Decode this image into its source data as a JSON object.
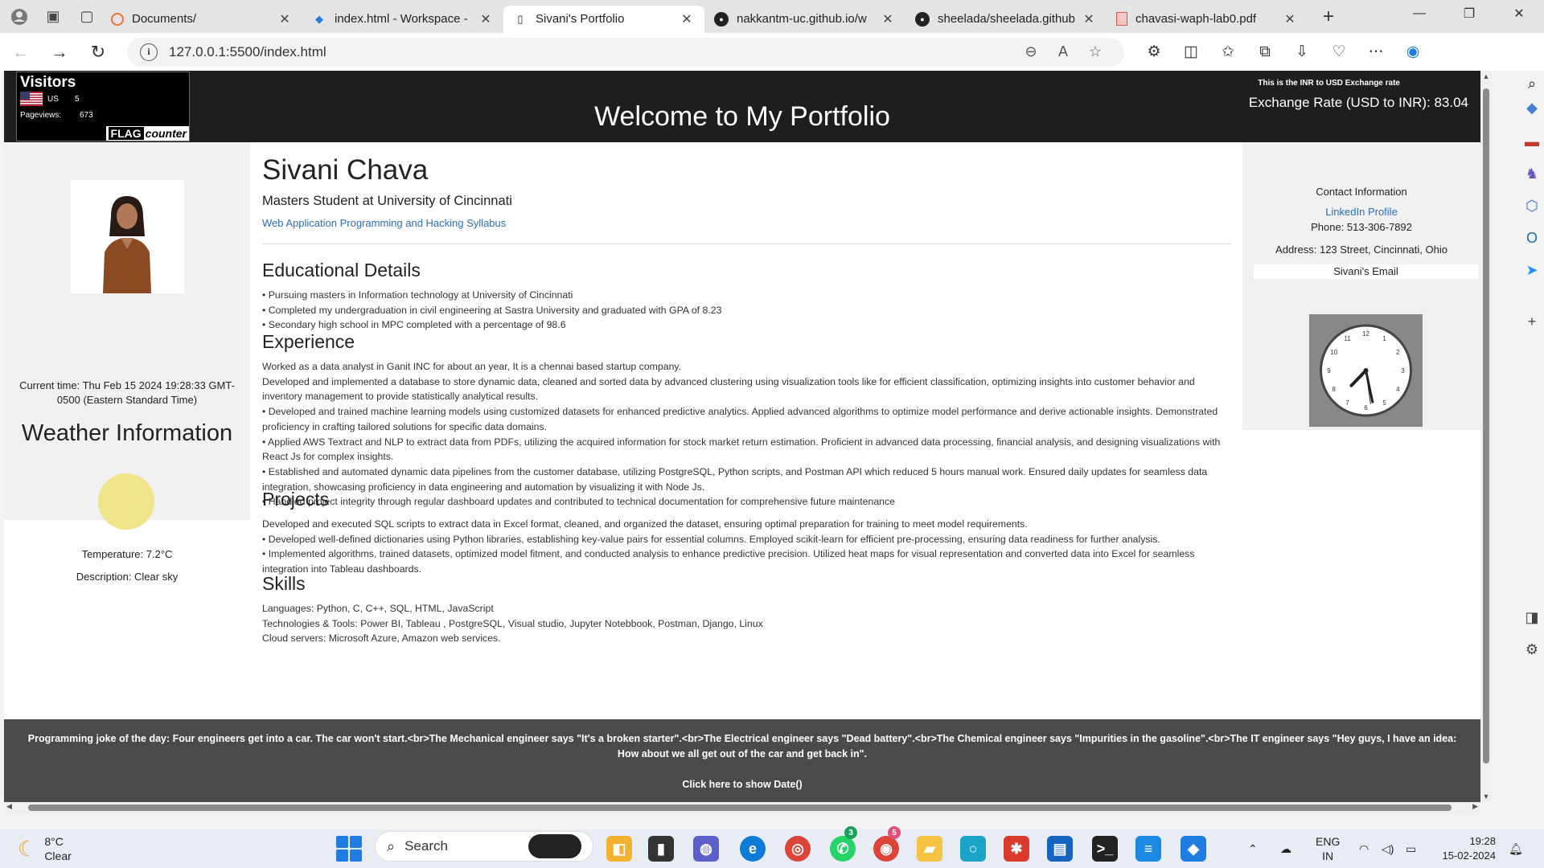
{
  "browser": {
    "tabs": [
      {
        "title": "Documents/",
        "favicon": "orange-ring-icon"
      },
      {
        "title": "index.html - Workspace -",
        "favicon": "vscode-icon"
      },
      {
        "title": "Sivani's Portfolio",
        "favicon": "page-icon"
      },
      {
        "title": "nakkantm-uc.github.io/w",
        "favicon": "github-icon"
      },
      {
        "title": "sheelada/sheelada.github",
        "favicon": "github-icon"
      },
      {
        "title": "chavasi-waph-lab0.pdf",
        "favicon": "pdf-icon"
      }
    ],
    "active_tab_index": 2,
    "url": "127.0.0.1:5500/index.html"
  },
  "page": {
    "flag_counter": {
      "title": "Visitors",
      "country": "US",
      "country_count": "5",
      "pageviews_label": "Pageviews:",
      "pageviews_value": "673",
      "logo_flag": "FLAG",
      "logo_counter": "counter"
    },
    "header_title": "Welcome to My Portfolio",
    "exchange_small": "This is the INR to USD Exchange rate",
    "exchange_rate": "Exchange Rate (USD to INR): 83.04",
    "left": {
      "current_time": "Current time: Thu Feb 15 2024 19:28:33 GMT-0500 (Eastern Standard Time)",
      "weather_heading": "Weather Information",
      "temperature": "Temperature: 7.2°C",
      "description": "Description: Clear sky"
    },
    "main": {
      "name": "Sivani Chava",
      "subtitle": "Masters Student at University of Cincinnati",
      "syllabus_link": "Web Application Programming and Hacking Syllabus",
      "education_heading": "Educational Details",
      "education": [
        "• Pursuing masters in Information technology at University of Cincinnati",
        "• Completed my undergraduation in civil engineering at Sastra University and graduated with GPA of 8.23",
        "• Secondary high school in MPC completed with a percentage of 98.6"
      ],
      "experience_heading": "Experience",
      "experience": [
        "Worked as a data analyst in Ganit INC for about an year, It is a chennai based startup company.",
        "Developed and implemented a database to store dynamic data, cleaned and sorted data by advanced clustering using visualization tools like for efficient classification, optimizing insights into customer behavior and inventory management to provide statistically analytical results.",
        "• Developed and trained machine learning models using customized datasets for enhanced predictive analytics. Applied advanced algorithms to optimize model performance and derive actionable insights. Demonstrated proficiency in crafting tailored solutions for specific data domains.",
        "• Applied AWS Textract and NLP to extract data from PDFs, utilizing the acquired information for stock market return estimation. Proficient in advanced data processing, financial analysis, and designing visualizations with React Js for complex insights.",
        "• Established and automated dynamic data pipelines from the customer database, utilizing PostgreSQL, Python scripts, and Postman API which reduced 5 hours manual work. Ensured daily updates for seamless data integration, showcasing proficiency in data engineering and automation by visualizing it with Node Js.",
        "• Handled project integrity through regular dashboard updates and contributed to technical documentation for comprehensive future maintenance"
      ],
      "projects_heading": "Projects",
      "projects": [
        "Developed and executed SQL scripts to extract data in Excel format, cleaned, and organized the dataset, ensuring optimal preparation for training to meet model requirements.",
        "• Developed well-defined dictionaries using Python libraries, establishing key-value pairs for essential columns. Employed scikit-learn for efficient pre-processing, ensuring data readiness for further analysis.",
        "• Implemented algorithms, trained datasets, optimized model fitment, and conducted analysis to enhance predictive precision. Utilized heat maps for visual representation and converted data into Excel for seamless integration into Tableau dashboards."
      ],
      "skills_heading": "Skills",
      "skills": [
        "Languages: Python, C, C++, SQL, HTML, JavaScript",
        "Technologies & Tools: Power BI, Tableau , PostgreSQL, Visual studio, Jupyter Notebbook, Postman, Django, Linux",
        "Cloud servers: Microsoft Azure, Amazon web services."
      ]
    },
    "right": {
      "contact_heading": "Contact Information",
      "linkedin": "LinkedIn Profile",
      "phone": "Phone: 513-306-7892",
      "address": "Address: 123 Street, Cincinnati, Ohio",
      "email": "Sivani's Email",
      "clock_numbers": [
        "12",
        "1",
        "2",
        "3",
        "4",
        "5",
        "6",
        "7",
        "8",
        "9",
        "10",
        "11"
      ],
      "clock_time": "7:28"
    },
    "footer": {
      "joke": "Programming joke of the day: Four engineers get into a car. The car won't start.<br>The Mechanical engineer says \"It's a broken starter\".<br>The Electrical engineer says \"Dead battery\".<br>The Chemical engineer says \"Impurities in the gasoline\".<br>The IT engineer says \"Hey guys, I have an idea: How about we all get out of the car and get back in\".",
      "date_button": "Click here to show Date()"
    }
  },
  "taskbar": {
    "weather_temp": "8°C",
    "weather_desc": "Clear",
    "search_placeholder": "Search",
    "lang_line1": "ENG",
    "lang_line2": "IN",
    "time": "19:28",
    "date": "15-02-2024",
    "whatsapp_badge": "3",
    "chrome_badge": "5"
  },
  "colors": {
    "header_bg": "#1e1e1e",
    "footer_bg": "#4a4a4a",
    "panel_bg": "#f1f1f1",
    "link": "#2a6fb8",
    "sun": "#efe48a"
  }
}
